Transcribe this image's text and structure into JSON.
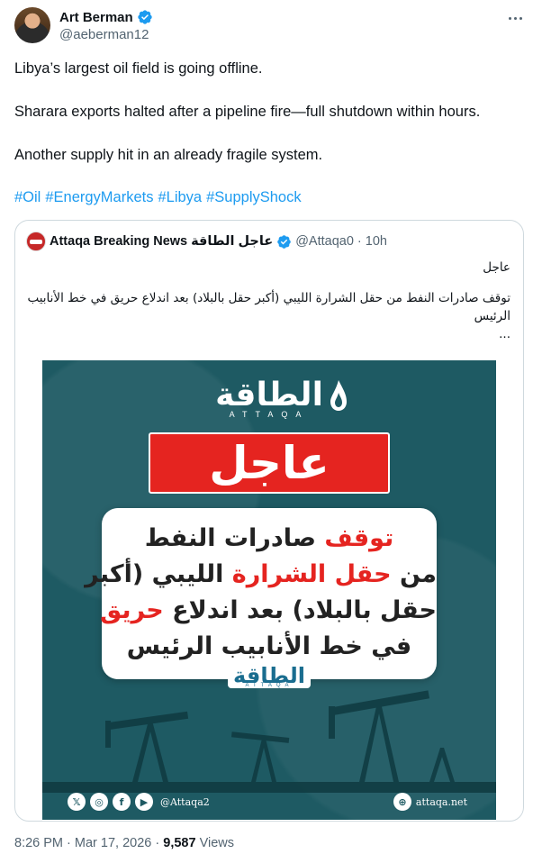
{
  "author": {
    "name": "Art Berman",
    "handle": "@aeberman12"
  },
  "tweet": {
    "line1": "Libya’s largest oil field is going offline.",
    "line2": "Sharara exports halted after a pipeline fire—full shutdown within hours.",
    "line3": "Another supply hit in an already fragile system.",
    "hashtags": [
      "#Oil",
      "#EnergyMarkets",
      "#Libya",
      "#SupplyShock"
    ]
  },
  "quoted": {
    "name": "Attaqa Breaking News عاجل الطاقة",
    "handle": "@Attaqa0",
    "separator": "·",
    "time": "10h",
    "label": "عاجل",
    "text_line1": "توقف صادرات النفط من حقل الشرارة الليبي (أكبر حقل بالبلاد) بعد اندلاع حريق في خط الأنابيب",
    "text_line2": "الرئيس",
    "ellipsis": "...",
    "image": {
      "logo_ar": "الطاقة",
      "logo_en": "ATTAQA",
      "urgent": "عاجل",
      "card_line1_a": "توقف",
      "card_line1_b": " صادرات النفط",
      "card_line2_a": "من ",
      "card_line2_b": "حقل الشرارة",
      "card_line2_c": " الليبي (أكبر",
      "card_line3_a": "حقل بالبلاد) بعد اندلاع ",
      "card_line3_b": "حريق",
      "card_line4": "في خط الأنابيب الرئيس",
      "small_logo_ar": "الطاقة",
      "small_logo_en": "ATTAQA",
      "social_handle": "@Attaqa2",
      "website": "attaqa.net"
    }
  },
  "meta": {
    "time": "8:26 PM",
    "dot": "·",
    "date": "Mar 17, 2026",
    "views_count": "9,587",
    "views_label": "Views"
  },
  "colors": {
    "accent_blue": "#1d9bf0",
    "banner_teal": "#1e5a63",
    "urgent_red": "#e52420"
  },
  "icons": [
    "verified-badge-icon",
    "more-options-icon",
    "x-logo-icon",
    "instagram-icon",
    "facebook-icon",
    "youtube-icon",
    "globe-icon"
  ]
}
